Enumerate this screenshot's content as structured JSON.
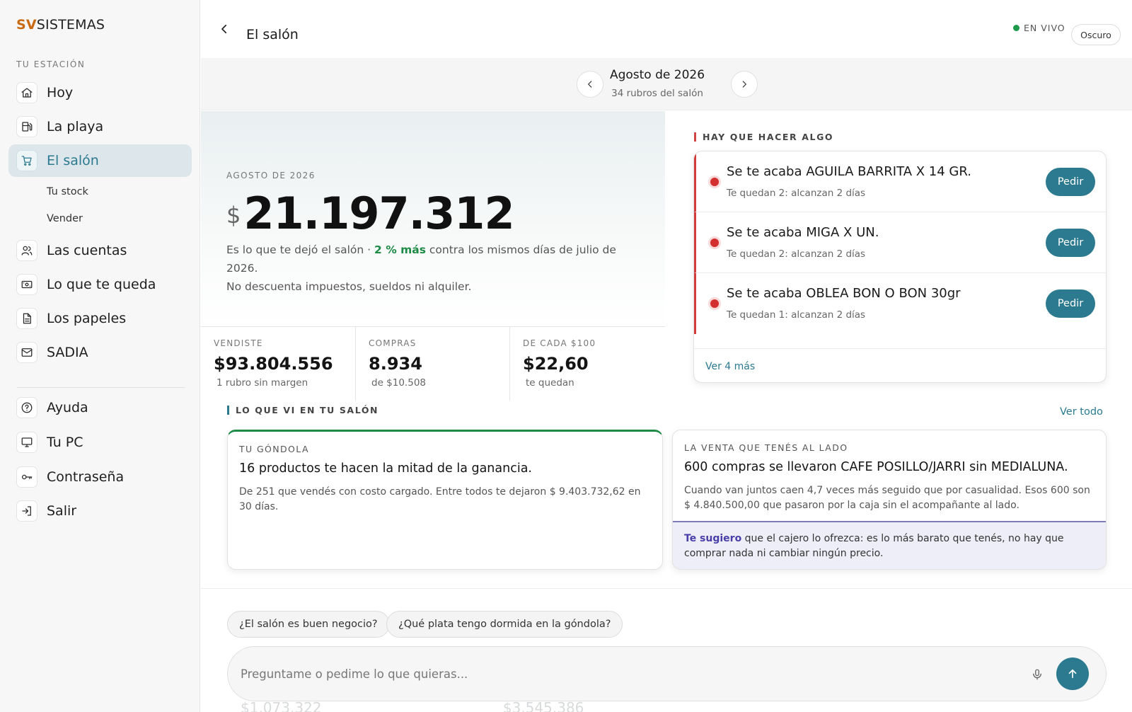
{
  "brand": {
    "prefix": "SV",
    "name": "SISTEMAS"
  },
  "sidebar": {
    "section_label": "TU ESTACIÓN",
    "items": [
      {
        "label": "Hoy",
        "icon": "home-icon"
      },
      {
        "label": "La playa",
        "icon": "fuel-pump-icon"
      },
      {
        "label": "El salón",
        "icon": "cart-icon",
        "active": true
      },
      {
        "label": "Las cuentas",
        "icon": "users-icon"
      },
      {
        "label": "Lo que te queda",
        "icon": "cash-icon"
      },
      {
        "label": "Los papeles",
        "icon": "document-icon"
      },
      {
        "label": "SADIA",
        "icon": "mail-icon"
      }
    ],
    "subitems": [
      "Tu stock",
      "Vender"
    ],
    "bottom_items": [
      {
        "label": "Ayuda",
        "icon": "help-icon"
      },
      {
        "label": "Tu PC",
        "icon": "monitor-icon"
      },
      {
        "label": "Contraseña",
        "icon": "key-icon"
      },
      {
        "label": "Salir",
        "icon": "logout-icon"
      }
    ]
  },
  "header": {
    "title": "El salón",
    "live_label": "EN VIVO",
    "theme_button": "Oscuro"
  },
  "period": {
    "title": "Agosto de 2026",
    "subtitle": "34 rubros del salón"
  },
  "hero": {
    "label": "AGOSTO DE 2026",
    "currency": "$",
    "amount": "21.197.312",
    "desc_part1": "Es lo que te dejó el salón · ",
    "desc_pct": "2 % más",
    "desc_part2": " contra los mismos días de julio de 2026.",
    "desc_line2": "No descuenta impuestos, sueldos ni alquiler."
  },
  "stats": [
    {
      "key": "VENDISTE",
      "value": "$93.804.556",
      "sub": "1 rubro sin margen"
    },
    {
      "key": "COMPRAS",
      "value": "8.934",
      "sub": "de $10.508"
    },
    {
      "key": "DE CADA $100",
      "value": "$22,60",
      "sub": "te quedan"
    }
  ],
  "alerts": {
    "heading": "HAY QUE HACER ALGO",
    "items": [
      {
        "title": "Se te acaba AGUILA BARRITA X 14 GR.",
        "sub": "Te quedan 2: alcanzan 2 días",
        "action": "Pedir"
      },
      {
        "title": "Se te acaba MIGA X UN.",
        "sub": "Te quedan 2: alcanzan 2 días",
        "action": "Pedir"
      },
      {
        "title": "Se te acaba OBLEA BON O BON 30gr",
        "sub": "Te quedan 1: alcanzan 2 días",
        "action": "Pedir"
      }
    ],
    "more_link": "Ver 4 más"
  },
  "insights": {
    "heading": "LO QUE VI EN TU SALÓN",
    "see_all": "Ver todo",
    "cards": [
      {
        "kicker": "TU GÓNDOLA",
        "headline": "16 productos te hacen la mitad de la ganancia.",
        "body": "De 251 que vendés con costo cargado. Entre todos te dejaron $ 9.403.732,62 en 30 días."
      },
      {
        "kicker": "LA VENTA QUE TENÉS AL LADO",
        "headline": "600 compras se llevaron CAFE POSILLO/JARRI sin MEDIALUNA.",
        "body": "Cuando van juntos caen 4,7 veces más seguido que por casualidad. Esos 600 son $ 4.840.500,00 que pasaron por la caja sin el acompañante al lado.",
        "suggest_em": "Te sugiero",
        "suggest_rest": " que el cajero lo ofrezca: es lo más barato que tenés, no hay que comprar nada ni cambiar ningún precio."
      }
    ]
  },
  "chat": {
    "chips": [
      "¿El salón es buen negocio?",
      "¿Qué plata tengo dormida en la góndola?"
    ],
    "placeholder": "Preguntame o pedime lo que quieras...",
    "faded_values": [
      "$1.073.322",
      "$3.545.386"
    ]
  },
  "colors": {
    "accent": "#2b7a8f",
    "brand": "#c96a12",
    "positive": "#1d8a45",
    "alert": "#d32f2f",
    "suggest": "#4a3fa8"
  }
}
